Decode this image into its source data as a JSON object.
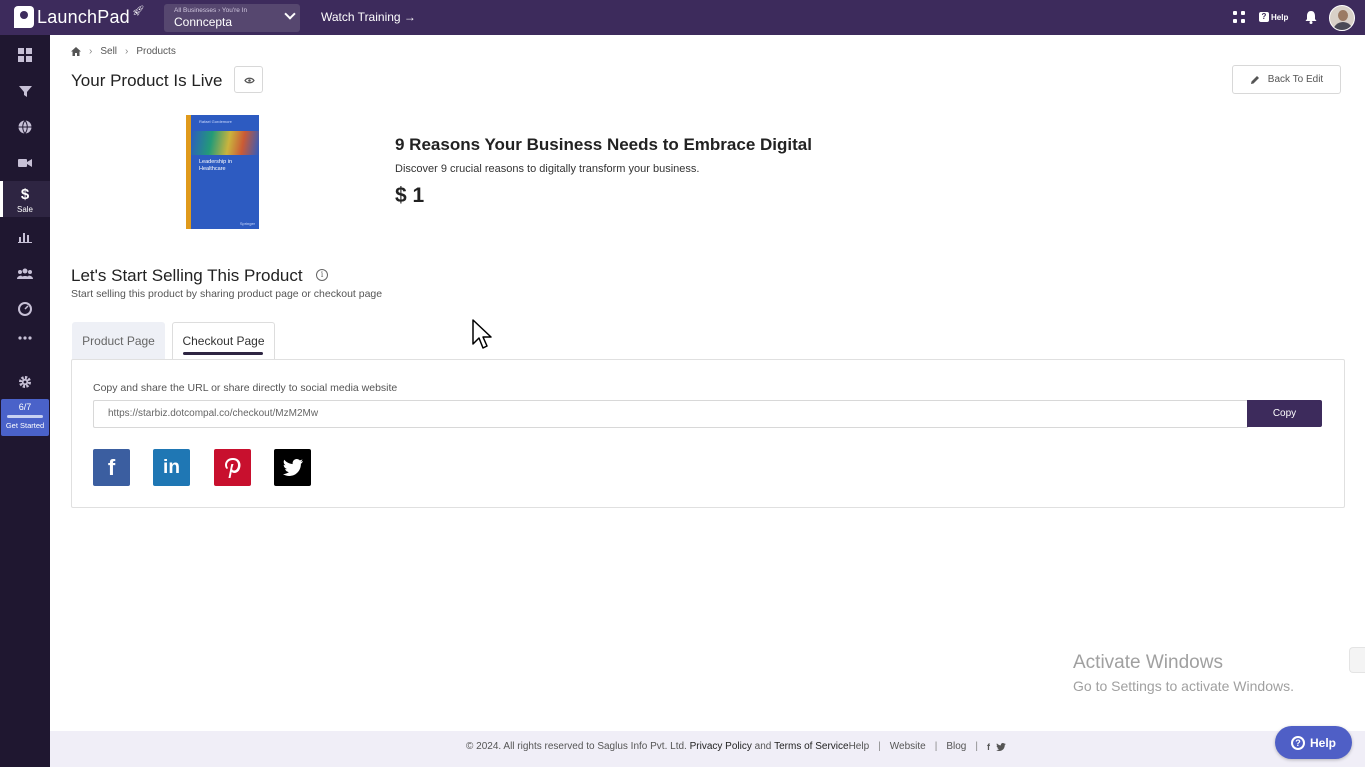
{
  "topbar": {
    "brand": "LaunchPad",
    "business_crumb": "All Businesses › You're In",
    "business_name": "Conncepta",
    "watch_training": "Watch Training →",
    "help_label": "Help"
  },
  "sidebar": {
    "active_label": "Sale",
    "progress": "6/7",
    "get_started": "Get Started"
  },
  "breadcrumb": {
    "items": [
      "Sell",
      "Products"
    ]
  },
  "page": {
    "title": "Your Product Is Live",
    "back_to_edit": "Back To Edit"
  },
  "book": {
    "author": "Rafael Gordemore",
    "title": "Leadership in Healthcare",
    "publisher": "Springer"
  },
  "product": {
    "title": "9 Reasons Your Business Needs to Embrace Digital",
    "description": "Discover 9 crucial reasons to digitally transform your business.",
    "price": "$ 1"
  },
  "selling": {
    "title": "Let's Start Selling This Product",
    "subtitle": "Start selling this product by sharing product page or checkout page",
    "tabs": [
      "Product Page",
      "Checkout Page"
    ],
    "share_label": "Copy and share the URL or share directly to social media website",
    "url": "https://starbiz.dotcompal.co/checkout/MzM2Mw",
    "copy": "Copy"
  },
  "watermark": {
    "line1": "Activate Windows",
    "line2": "Go to Settings to activate Windows."
  },
  "footer": {
    "copyright": "©  2024. All rights reserved to Saglus Info Pvt. Ltd.",
    "privacy": "Privacy Policy",
    "and": "and",
    "terms": "Terms of Service",
    "help": "Help",
    "website": "Website",
    "blog": "Blog"
  },
  "help_fab": "Help",
  "colors": {
    "topbar": "#3d2b5c",
    "sidebar": "#1f1730",
    "accent": "#4f5fc6"
  }
}
